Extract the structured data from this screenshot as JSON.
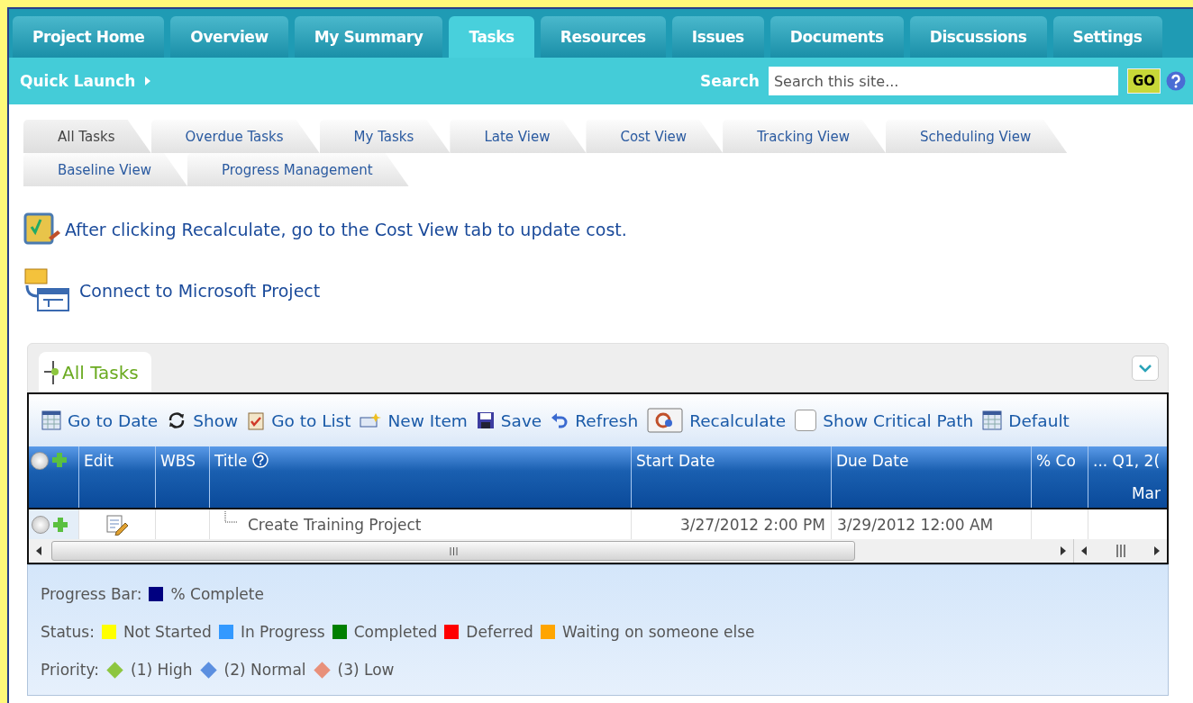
{
  "nav_tabs": [
    {
      "label": "Project Home",
      "selected": false
    },
    {
      "label": "Overview",
      "selected": false
    },
    {
      "label": "My Summary",
      "selected": false
    },
    {
      "label": "Tasks",
      "selected": true
    },
    {
      "label": "Resources",
      "selected": false
    },
    {
      "label": "Issues",
      "selected": false
    },
    {
      "label": "Documents",
      "selected": false
    },
    {
      "label": "Discussions",
      "selected": false
    },
    {
      "label": "Settings",
      "selected": false
    }
  ],
  "quick_launch": {
    "label": "Quick Launch"
  },
  "search": {
    "label": "Search",
    "placeholder": "Search this site...",
    "button": "GO"
  },
  "view_tab_rows": [
    [
      {
        "label": "All Tasks",
        "selected": true
      },
      {
        "label": "Overdue Tasks",
        "selected": false
      },
      {
        "label": "My Tasks",
        "selected": false
      },
      {
        "label": "Late View",
        "selected": false
      },
      {
        "label": "Cost View",
        "selected": false
      },
      {
        "label": "Tracking View",
        "selected": false
      },
      {
        "label": "Scheduling View",
        "selected": false
      }
    ],
    [
      {
        "label": "Baseline View",
        "selected": false
      },
      {
        "label": "Progress Management",
        "selected": false
      }
    ]
  ],
  "notes": [
    {
      "kind": "recalc",
      "text": "After clicking Recalculate, go to the Cost View tab to update cost."
    },
    {
      "kind": "connect",
      "text": "Connect to Microsoft Project"
    }
  ],
  "web_part": {
    "title": "All Tasks"
  },
  "toolbar": [
    {
      "kind": "calendar",
      "label": "Go to Date"
    },
    {
      "kind": "cycle",
      "label": "Show"
    },
    {
      "kind": "clipboard",
      "label": "Go to List"
    },
    {
      "kind": "new",
      "label": "New Item"
    },
    {
      "kind": "save",
      "label": "Save"
    },
    {
      "kind": "undo",
      "label": "Refresh"
    },
    {
      "kind": "recalc",
      "label": "Recalculate"
    },
    {
      "kind": "checkbox",
      "label": "Show Critical Path",
      "checked": false
    },
    {
      "kind": "grid",
      "label": "Default"
    }
  ],
  "columns": [
    "Edit",
    "WBS",
    "Title",
    "Start Date",
    "Due Date",
    "% Co",
    "... Q1, 2("
  ],
  "gantt_sub": "Mar",
  "select_all": {
    "selected": false
  },
  "rows": [
    {
      "selected": false,
      "title": "Create Training Project",
      "start": "3/27/2012 2:00 PM",
      "due": "3/29/2012 12:00 AM"
    }
  ],
  "legend": {
    "progress": {
      "label": "Progress Bar:",
      "items": [
        {
          "label": "% Complete",
          "color": "#000080"
        }
      ]
    },
    "status": {
      "label": "Status:",
      "items": [
        {
          "label": "Not Started",
          "color": "#ffff00"
        },
        {
          "label": "In Progress",
          "color": "#3399ff"
        },
        {
          "label": "Completed",
          "color": "#008000"
        },
        {
          "label": "Deferred",
          "color": "#ff0000"
        },
        {
          "label": "Waiting on someone else",
          "color": "#ffa500"
        }
      ]
    },
    "priority": {
      "label": "Priority:",
      "items": [
        {
          "label": "(1) High",
          "color": "#8dc63f"
        },
        {
          "label": "(2) Normal",
          "color": "#5b8fe0"
        },
        {
          "label": "(3) Low",
          "color": "#e8907a"
        }
      ]
    }
  }
}
